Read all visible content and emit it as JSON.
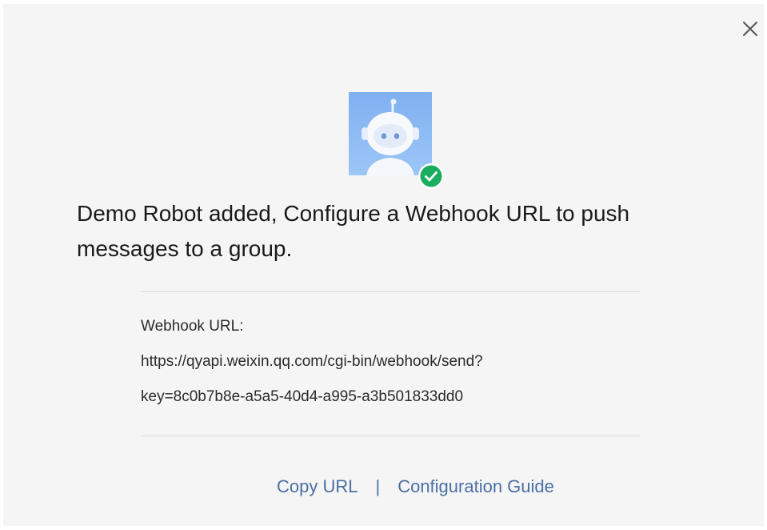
{
  "dialog": {
    "close_icon": "close-icon",
    "avatar_icon": "robot-avatar-icon",
    "badge_icon": "check-circle-icon",
    "headline": "Demo Robot added, Configure a Webhook URL to push messages to a group.",
    "webhook_label": "Webhook URL:",
    "webhook_url_line1": "https://qyapi.weixin.qq.com/cgi-bin/webhook/send?",
    "webhook_url_line2": "key=8c0b7b8e-a5a5-40d4-a995-a3b501833dd0",
    "actions": {
      "copy_url": "Copy URL",
      "separator": "|",
      "config_guide": "Configuration Guide"
    }
  },
  "colors": {
    "link": "#4a6fa5",
    "success": "#1aad5f",
    "avatar_bg": "#86b7f2",
    "background": "#f5f5f5"
  }
}
